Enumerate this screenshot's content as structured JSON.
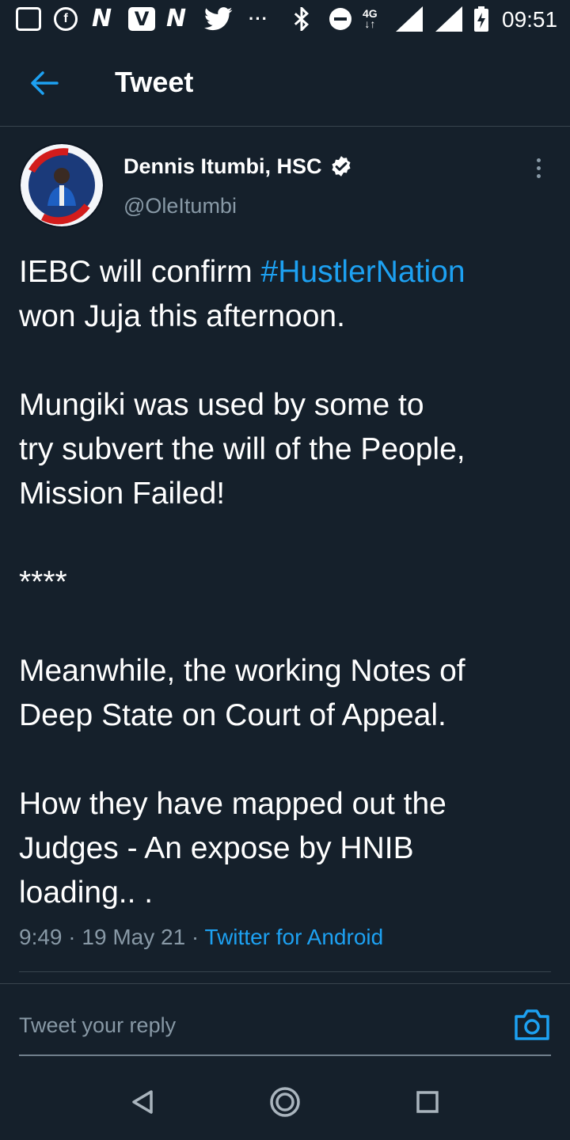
{
  "status_bar": {
    "time": "09:51",
    "network": "4G",
    "app_letter_n": "N",
    "app_letter_v": "V",
    "overflow": "···"
  },
  "header": {
    "title": "Tweet"
  },
  "tweet": {
    "author_name": "Dennis Itumbi, HSC",
    "author_handle": "@OleItumbi",
    "text_part1": "IEBC will confirm ",
    "hashtag": "#HustlerNation",
    "text_part2": "\nwon Juja this afternoon.\n\nMungiki was used by some to\ntry subvert the will of the People,\nMission Failed!\n\n****\n\nMeanwhile, the working Notes of\nDeep State on Court of Appeal.\n\nHow they have mapped out the\nJudges - An expose by HNIB\nloading.. .",
    "time": "9:49",
    "date": "19 May 21",
    "separator": "·",
    "source": "Twitter for Android"
  },
  "reply": {
    "placeholder": "Tweet your reply"
  },
  "colors": {
    "background": "#15202b",
    "accent": "#1da1f2",
    "secondary_text": "#8899a6",
    "divider": "#38444d"
  }
}
